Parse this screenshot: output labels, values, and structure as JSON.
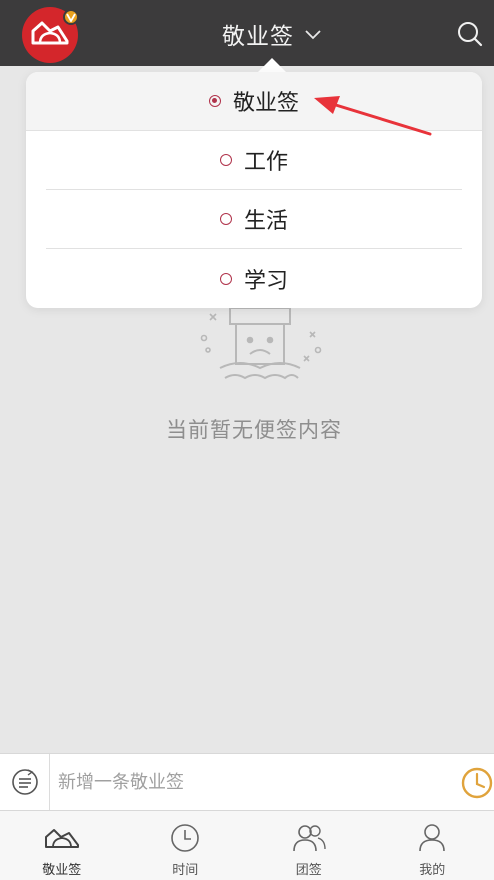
{
  "header": {
    "title": "敬业签",
    "avatar_icon": "cloud-logo-icon",
    "badge_icon": "vip-badge-icon",
    "dropdown_icon": "chevron-down-icon",
    "search_icon": "search-icon"
  },
  "dropdown": {
    "items": [
      {
        "label": "敬业签",
        "selected": true
      },
      {
        "label": "工作",
        "selected": false
      },
      {
        "label": "生活",
        "selected": false
      },
      {
        "label": "学习",
        "selected": false
      }
    ]
  },
  "empty_state": {
    "message": "当前暂无便签内容",
    "illustration": "sad-box-illustration"
  },
  "composer": {
    "placeholder": "新增一条敬业签",
    "left_icon": "switch-icon",
    "right_icon": "clock-icon"
  },
  "tabs": [
    {
      "label": "敬业签",
      "icon": "cloud-icon",
      "active": true
    },
    {
      "label": "时间",
      "icon": "clock-icon",
      "active": false
    },
    {
      "label": "团签",
      "icon": "group-icon",
      "active": false
    },
    {
      "label": "我的",
      "icon": "user-icon",
      "active": false
    }
  ],
  "colors": {
    "header_bg": "#3c3b3c",
    "brand_red": "#d4262b",
    "radio_accent": "#b0334b",
    "annotation_red": "#e8333a",
    "clock_gold": "#e0a33c"
  }
}
